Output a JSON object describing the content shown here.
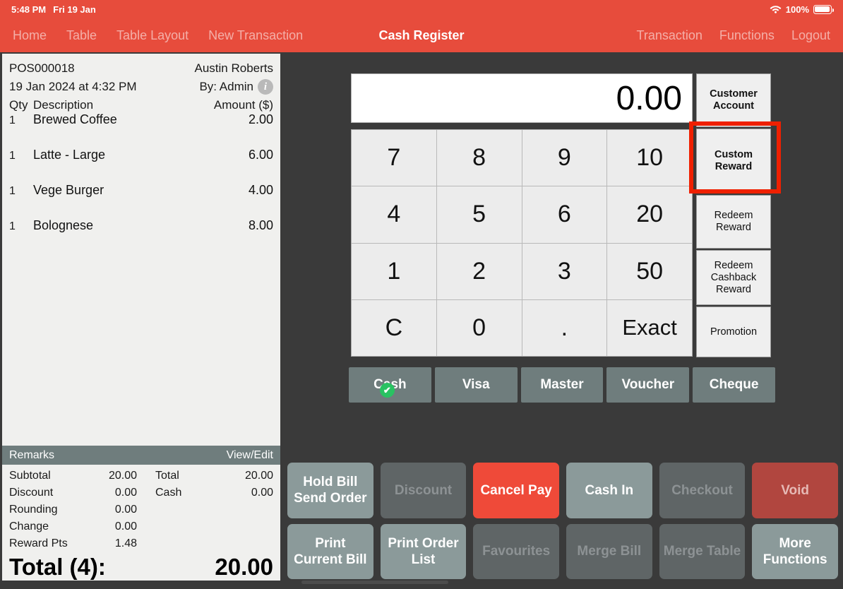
{
  "statusbar": {
    "time": "5:48 PM",
    "date": "Fri 19 Jan",
    "battery_percent": "100%",
    "wifi_icon": "wifi-icon",
    "battery_icon": "battery-icon"
  },
  "navbar": {
    "title": "Cash Register",
    "left_items": [
      {
        "label": "Home"
      },
      {
        "label": "Table"
      },
      {
        "label": "Table Layout"
      },
      {
        "label": "New Transaction"
      }
    ],
    "right_items": [
      {
        "label": "Transaction"
      },
      {
        "label": "Functions"
      },
      {
        "label": "Logout"
      }
    ]
  },
  "receipt": {
    "order_no": "POS000018",
    "customer": "Austin Roberts",
    "datetime": "19 Jan 2024 at 4:32 PM",
    "by": "By: Admin",
    "info_icon": "info-icon",
    "columns": {
      "qty": "Qty",
      "description": "Description",
      "amount": "Amount ($)"
    },
    "items": [
      {
        "qty": "1",
        "description": "Brewed Coffee",
        "amount": "2.00"
      },
      {
        "qty": "1",
        "description": "Latte - Large",
        "amount": "6.00"
      },
      {
        "qty": "1",
        "description": "Vege Burger",
        "amount": "4.00"
      },
      {
        "qty": "1",
        "description": "Bolognese",
        "amount": "8.00"
      }
    ],
    "remarks_label": "Remarks",
    "remarks_action": "View/Edit",
    "totals_left": [
      {
        "label": "Subtotal",
        "value": "20.00"
      },
      {
        "label": "Discount",
        "value": "0.00"
      },
      {
        "label": "Rounding",
        "value": "0.00"
      },
      {
        "label": "Change",
        "value": "0.00"
      },
      {
        "label": "Reward Pts",
        "value": "1.48"
      }
    ],
    "totals_right": [
      {
        "label": "Total",
        "value": "20.00"
      },
      {
        "label": "Cash",
        "value": "0.00"
      }
    ],
    "grand_total_label": "Total (4):",
    "grand_total_value": "20.00"
  },
  "keypad": {
    "display_value": "0.00",
    "keys": [
      {
        "label": "7"
      },
      {
        "label": "8"
      },
      {
        "label": "9"
      },
      {
        "label": "10"
      },
      {
        "label": "4"
      },
      {
        "label": "5"
      },
      {
        "label": "6"
      },
      {
        "label": "20"
      },
      {
        "label": "1"
      },
      {
        "label": "2"
      },
      {
        "label": "3"
      },
      {
        "label": "50"
      },
      {
        "label": "C"
      },
      {
        "label": "0"
      },
      {
        "label": "."
      },
      {
        "label": "Exact"
      }
    ]
  },
  "side_buttons": [
    {
      "label": "Customer Account",
      "name": "customer-account-button"
    },
    {
      "label": "Custom Reward",
      "name": "custom-reward-button"
    },
    {
      "label": "Redeem Reward",
      "name": "redeem-reward-button"
    },
    {
      "label": "Redeem Cashback Reward",
      "name": "redeem-cashback-reward-button"
    },
    {
      "label": "Promotion",
      "name": "promotion-button"
    }
  ],
  "highlight": {
    "target": "Custom Reward",
    "color": "#ef2000"
  },
  "payment_methods": [
    {
      "label": "Cash",
      "selected": true
    },
    {
      "label": "Visa",
      "selected": false
    },
    {
      "label": "Master",
      "selected": false
    },
    {
      "label": "Voucher",
      "selected": false
    },
    {
      "label": "Cheque",
      "selected": false
    }
  ],
  "actions": [
    {
      "label": "Hold Bill Send Order",
      "state": "enabled"
    },
    {
      "label": "Discount",
      "state": "disabled"
    },
    {
      "label": "Cancel Pay",
      "state": "danger"
    },
    {
      "label": "Cash In",
      "state": "enabled"
    },
    {
      "label": "Checkout",
      "state": "disabled"
    },
    {
      "label": "Void",
      "state": "void"
    },
    {
      "label": "Print Current Bill",
      "state": "enabled"
    },
    {
      "label": "Print Order List",
      "state": "enabled"
    },
    {
      "label": "Favourites",
      "state": "disabled"
    },
    {
      "label": "Merge Bill",
      "state": "disabled"
    },
    {
      "label": "Merge Table",
      "state": "disabled"
    },
    {
      "label": "More Functions",
      "state": "enabled"
    }
  ],
  "colors": {
    "brand_red": "#e74c3c",
    "highlight_red": "#ef2000",
    "panel_dark": "#3a3a3a",
    "receipt_bg": "#f0f0ee",
    "remarks_bar": "#6f7d7d",
    "payment_btn": "#6f7d7d",
    "action_enabled": "#8b9a9a",
    "action_disabled": "#5f6566",
    "danger": "#ef4a39",
    "void": "#b1463f",
    "check_green": "#29c262"
  }
}
